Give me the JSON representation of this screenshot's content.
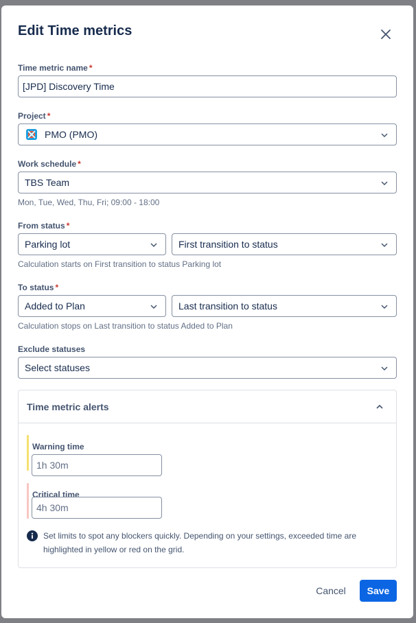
{
  "dialog": {
    "title": "Edit Time metrics"
  },
  "fields": {
    "name": {
      "label": "Time metric name",
      "required_mark": "*",
      "value": "[JPD] Discovery Time"
    },
    "project": {
      "label": "Project",
      "required_mark": "*",
      "value": "PMO (PMO)",
      "icon": "project-avatar-icon"
    },
    "work_schedule": {
      "label": "Work schedule",
      "required_mark": "*",
      "value": "TBS Team",
      "hint": "Mon, Tue, Wed, Thu, Fri; 09:00 - 18:00"
    },
    "from_status": {
      "label": "From status",
      "required_mark": "*",
      "status": "Parking lot",
      "transition": "First transition to status",
      "hint": "Calculation starts on First transition to status Parking lot"
    },
    "to_status": {
      "label": "To status",
      "required_mark": "*",
      "status": "Added to Plan",
      "transition": "Last transition to status",
      "hint": "Calculation stops on Last transition to status Added to Plan"
    },
    "exclude_statuses": {
      "label": "Exclude statuses",
      "placeholder": "Select statuses"
    }
  },
  "alerts": {
    "title": "Time metric alerts",
    "warning": {
      "label": "Warning time",
      "placeholder": "1h 30m",
      "color": "#f5e06e"
    },
    "critical": {
      "label": "Critical time",
      "placeholder": "4h 30m",
      "color": "#f8c6c2"
    },
    "info": "Set limits to spot any blockers quickly. Depending on your settings, exceeded time are highlighted in yellow or red on the grid."
  },
  "footer": {
    "cancel_label": "Cancel",
    "save_label": "Save"
  },
  "colors": {
    "primary": "#0c66e4",
    "required": "#c9372c",
    "text": "#172b4d",
    "subtle_text": "#626f86"
  }
}
